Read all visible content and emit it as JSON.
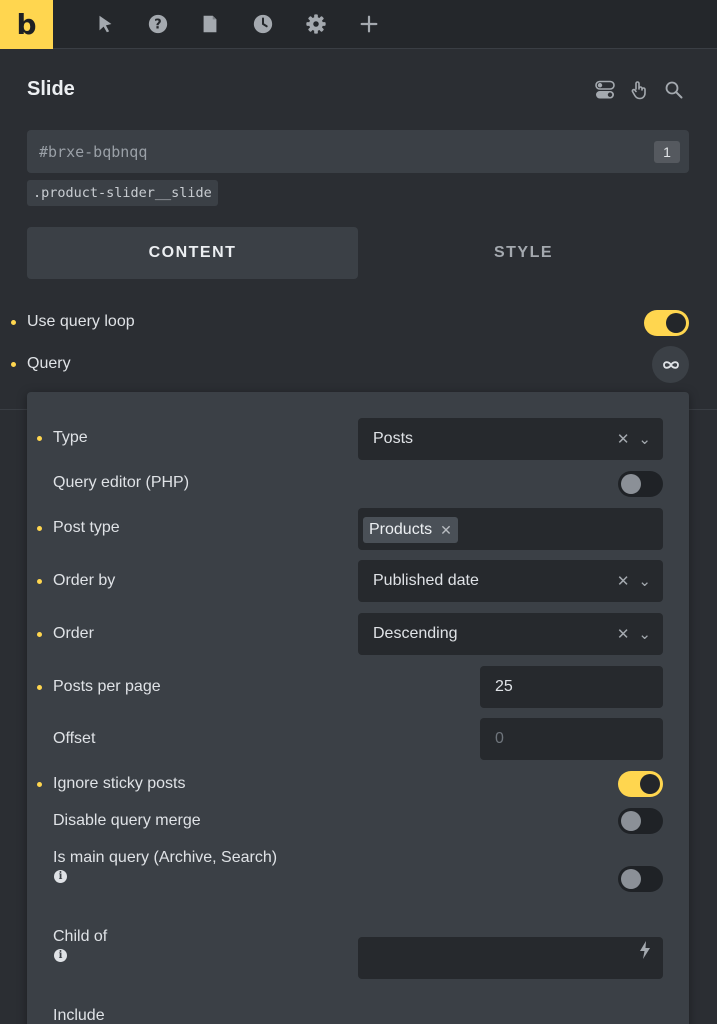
{
  "toolbar": {
    "logo": "b",
    "icons": [
      "pointer-icon",
      "help-icon",
      "page-icon",
      "history-icon",
      "settings-icon",
      "add-icon"
    ]
  },
  "panel": {
    "title": "Slide",
    "element_id": "#brxe-bqbnqq",
    "element_id_count": "1",
    "css_class": ".product-slider__slide",
    "header_icons": [
      "toggle-icon",
      "hand-pointer-icon",
      "search-icon"
    ]
  },
  "tabs": {
    "content": "CONTENT",
    "style": "STYLE",
    "active": "content"
  },
  "settings": {
    "use_query_loop": {
      "label": "Use query loop",
      "enabled": true
    },
    "query": {
      "label": "Query",
      "button_icon": "infinity-icon"
    }
  },
  "query_popup": {
    "type": {
      "label": "Type",
      "value": "Posts"
    },
    "query_editor": {
      "label": "Query editor (PHP)",
      "enabled": false
    },
    "post_type": {
      "label": "Post type",
      "tag": "Products"
    },
    "order_by": {
      "label": "Order by",
      "value": "Published date"
    },
    "order": {
      "label": "Order",
      "value": "Descending"
    },
    "posts_per_page": {
      "label": "Posts per page",
      "value": "25"
    },
    "offset": {
      "label": "Offset",
      "placeholder": "0"
    },
    "ignore_sticky": {
      "label": "Ignore sticky posts",
      "enabled": true
    },
    "disable_merge": {
      "label": "Disable query merge",
      "enabled": false
    },
    "is_main_query": {
      "label": "Is main query (Archive, Search)",
      "enabled": false
    },
    "child_of": {
      "label": "Child of",
      "value": ""
    },
    "include": {
      "label": "Include"
    }
  },
  "colors": {
    "accent": "#ffd64f",
    "panel_bg": "#2b2e33",
    "popup_bg": "#3b4046",
    "field_bg": "#26292d"
  }
}
